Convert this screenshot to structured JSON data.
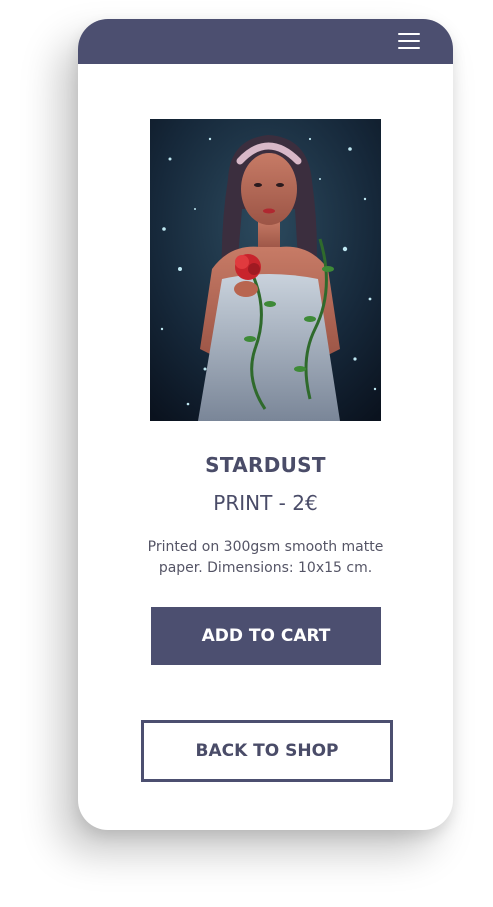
{
  "header": {
    "menu_icon": "hamburger-menu-icon",
    "bar_color": "#4c4f70"
  },
  "product": {
    "image_description": "Illustrated portrait of a woman with braided hair holding a red rose, starry background",
    "title": "STARDUST",
    "subtitle": "PRINT - 2€",
    "description": "Printed on 300gsm smooth matte paper. Dimensions: 10x15 cm."
  },
  "actions": {
    "add_to_cart_label": "ADD TO CART",
    "back_to_shop_label": "BACK TO SHOP"
  },
  "colors": {
    "accent": "#4c4f70",
    "text": "#4a4c68",
    "background": "#ffffff"
  }
}
